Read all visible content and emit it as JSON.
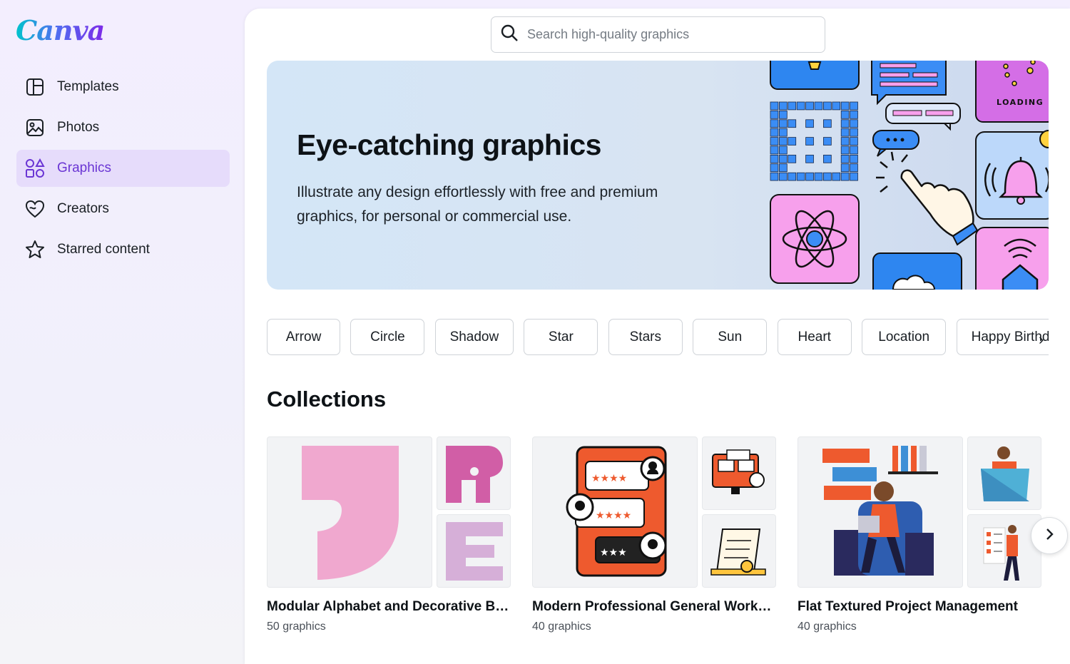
{
  "app": {
    "logo": "Canva"
  },
  "sidebar": {
    "items": [
      {
        "label": "Templates",
        "icon": "templates-icon",
        "active": false
      },
      {
        "label": "Photos",
        "icon": "photo-icon",
        "active": false
      },
      {
        "label": "Graphics",
        "icon": "shapes-icon",
        "active": true
      },
      {
        "label": "Creators",
        "icon": "heart-icon",
        "active": false
      },
      {
        "label": "Starred content",
        "icon": "star-icon",
        "active": false
      }
    ]
  },
  "search": {
    "placeholder": "Search high-quality graphics",
    "value": ""
  },
  "hero": {
    "title": "Eye-catching graphics",
    "description": "Illustrate any design effortlessly with free and premium graphics, for personal or commercial use.",
    "art_label": "LOADING"
  },
  "chips": [
    "Arrow",
    "Circle",
    "Shadow",
    "Star",
    "Stars",
    "Sun",
    "Heart",
    "Location",
    "Happy Birthday"
  ],
  "collections": {
    "title": "Collections",
    "items": [
      {
        "name": "Modular Alphabet and Decorative Bl...",
        "count": "50 graphics"
      },
      {
        "name": "Modern Professional General Work Ic...",
        "count": "40 graphics"
      },
      {
        "name": "Flat Textured Project Management",
        "count": "40 graphics"
      }
    ]
  },
  "colors": {
    "accent": "#7d2ae8",
    "active_bg": "#e6dcfb",
    "active_text": "#6a35d4",
    "hero_bg": "#d4e6f7"
  }
}
